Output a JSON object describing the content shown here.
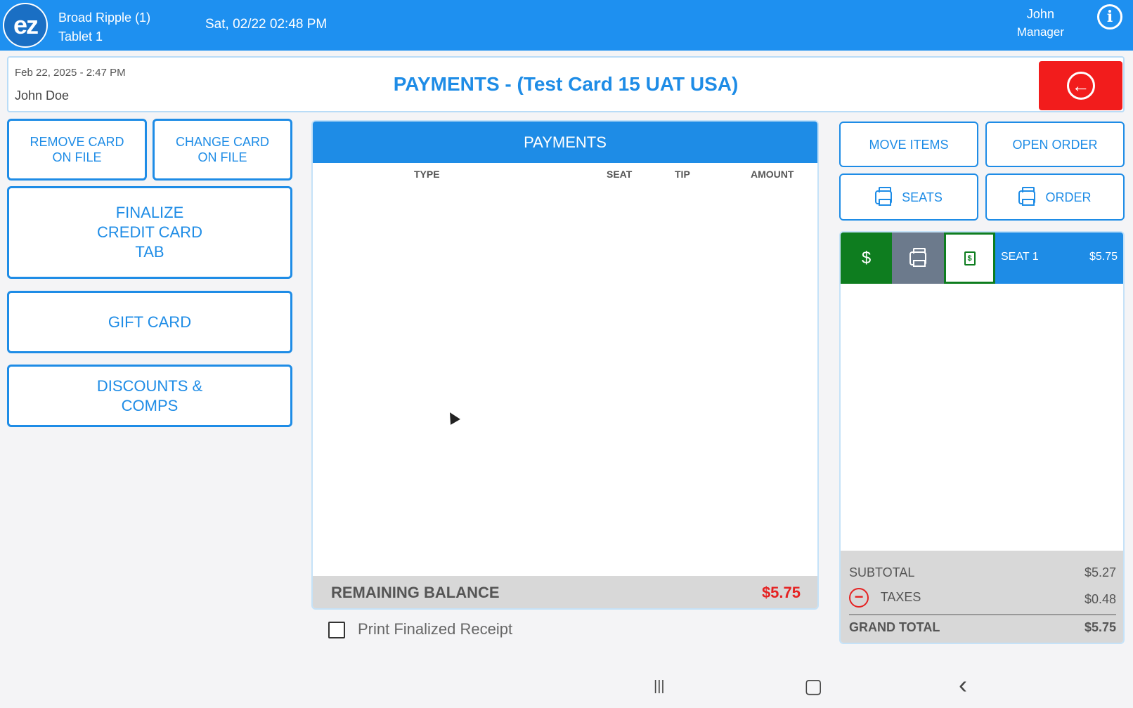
{
  "topbar": {
    "logo_text": "ez",
    "location": "Broad Ripple (1)",
    "device": "Tablet 1",
    "datetime": "Sat, 02/22 02:48 PM",
    "user_name": "John",
    "user_role": "Manager",
    "info_icon": "info-icon"
  },
  "header": {
    "date": "Feb 22, 2025  - 2:47 PM",
    "customer": "John Doe",
    "title": "PAYMENTS - (Test Card 15 UAT USA)",
    "back_icon": "back-arrow-icon",
    "back_color": "#f21c1c"
  },
  "left_actions": {
    "remove_card": "REMOVE CARD\nON FILE",
    "change_card": "CHANGE CARD\nON FILE",
    "finalize_tab": "FINALIZE\nCREDIT CARD\nTAB",
    "gift_card": "GIFT CARD",
    "discounts": "DISCOUNTS &\nCOMPS"
  },
  "payments": {
    "header": "PAYMENTS",
    "columns": [
      "TYPE",
      "SEAT",
      "TIP",
      "AMOUNT"
    ],
    "rows": [],
    "remaining_label": "REMAINING BALANCE",
    "remaining_value": "$5.75",
    "print_receipt_label": "Print Finalized Receipt",
    "print_receipt_checked": false
  },
  "right_actions": {
    "move_items": "MOVE ITEMS",
    "open_order": "OPEN ORDER",
    "print_seats": "SEATS",
    "print_order": "ORDER"
  },
  "seats": [
    {
      "label": "SEAT 1",
      "amount": "$5.75",
      "pay_icon": "$"
    }
  ],
  "totals": {
    "subtotal_label": "SUBTOTAL",
    "subtotal": "$5.27",
    "taxes_label": "TAXES",
    "taxes": "$0.48",
    "grand_total_label": "GRAND TOTAL",
    "grand_total": "$5.75"
  },
  "colors": {
    "brand_blue": "#1e8ce6",
    "topbar_blue": "#1e90f0",
    "pay_green": "#0e7d1f",
    "alert_red": "#e52222"
  },
  "navbar": {
    "recents": "|||",
    "home": "▢",
    "back": "‹"
  }
}
